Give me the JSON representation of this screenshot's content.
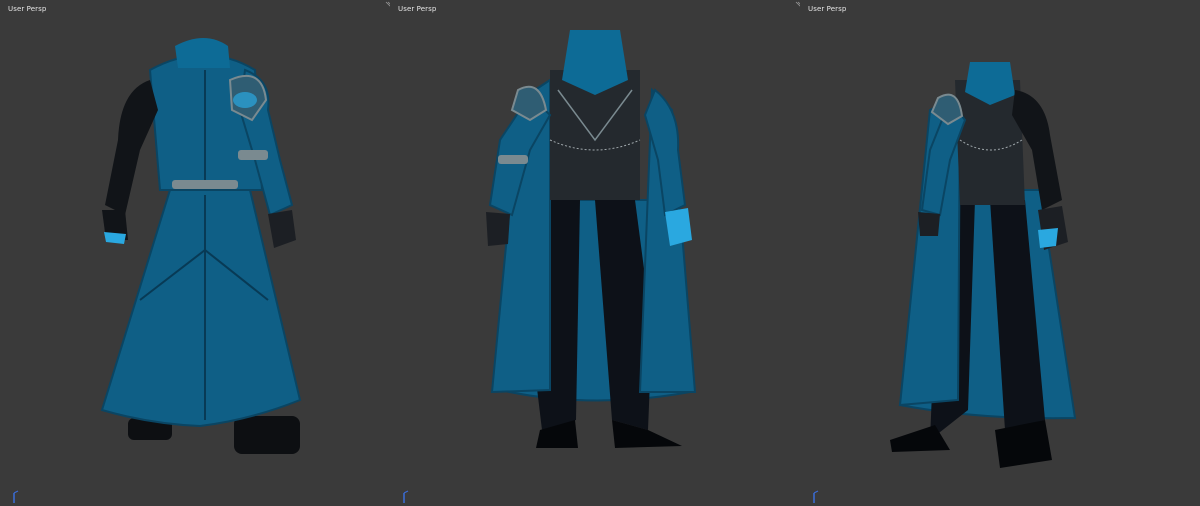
{
  "viewports": [
    {
      "label": "User Persp",
      "view": "back"
    },
    {
      "label": "User Persp",
      "view": "front"
    },
    {
      "label": "User Persp",
      "view": "three-quarter"
    }
  ],
  "colors": {
    "background": "#3a3a3a",
    "coat": "#0f5f86",
    "coat_dark": "#083a55",
    "sleeve": "#111418",
    "glow": "#2aa8e0",
    "trim": "#7a8a90"
  }
}
